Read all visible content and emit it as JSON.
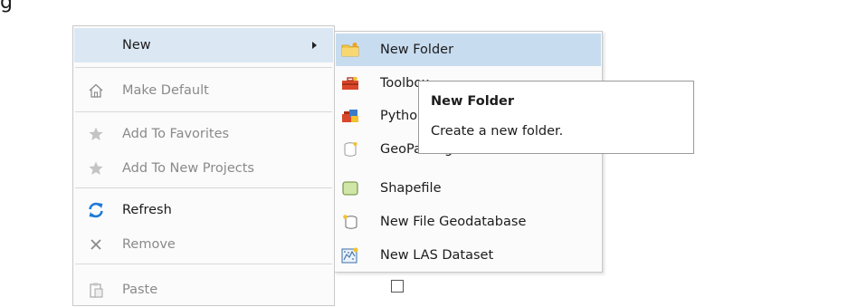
{
  "background_text": "g",
  "context_menu": {
    "items": [
      {
        "label": "New",
        "icon": "none",
        "enabled": true,
        "highlighted": true,
        "has_submenu": true
      },
      {
        "label": "Make Default",
        "icon": "home-icon",
        "enabled": false
      },
      {
        "label": "Add To Favorites",
        "icon": "star-icon",
        "enabled": false
      },
      {
        "label": "Add To New Projects",
        "icon": "star-icon",
        "enabled": false
      },
      {
        "label": "Refresh",
        "icon": "refresh-icon",
        "enabled": true
      },
      {
        "label": "Remove",
        "icon": "close-icon",
        "enabled": false
      },
      {
        "label": "Paste",
        "icon": "paste-icon",
        "enabled": false
      }
    ]
  },
  "submenu": {
    "items": [
      {
        "label": "New Folder",
        "icon": "folder-icon",
        "highlighted": true
      },
      {
        "label": "Toolbox",
        "icon": "toolbox-icon"
      },
      {
        "label": "Python Toolbox",
        "icon": "python-toolbox-icon"
      },
      {
        "label": "GeoPackage",
        "icon": "geopackage-icon"
      },
      {
        "label": "Shapefile",
        "icon": "shapefile-icon"
      },
      {
        "label": "New File Geodatabase",
        "icon": "geodatabase-icon"
      },
      {
        "label": "New LAS Dataset",
        "icon": "las-dataset-icon"
      }
    ]
  },
  "tooltip": {
    "title": "New Folder",
    "description": "Create a new folder."
  },
  "colors": {
    "highlight": "#dbe8f4",
    "submenu_highlight": "#c8dcf0",
    "disabled_text": "#8a8a8a",
    "refresh_blue": "#1e7ad6"
  }
}
